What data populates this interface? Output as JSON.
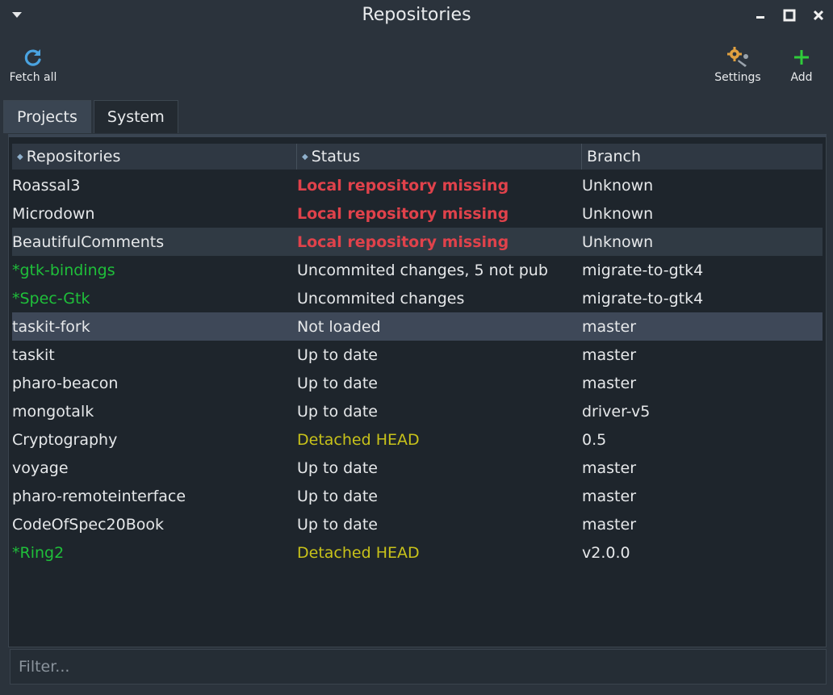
{
  "window": {
    "title": "Repositories",
    "menu_icon": "triangle-down-icon",
    "controls": [
      "minimize-icon",
      "maximize-icon",
      "close-icon"
    ]
  },
  "toolbar": {
    "fetch_all": {
      "label": "Fetch all",
      "icon": "refresh-icon",
      "color": "#4aa3e0"
    },
    "settings": {
      "label": "Settings",
      "icon": "gear-wrench-icon",
      "color": "#e0a040"
    },
    "add": {
      "label": "Add",
      "icon": "plus-icon",
      "color": "#2fcc3a"
    }
  },
  "tabs": [
    {
      "label": "Projects",
      "active": true
    },
    {
      "label": "System",
      "active": false
    }
  ],
  "table": {
    "columns": [
      "Repositories",
      "Status",
      "Branch"
    ],
    "rows": [
      {
        "name": "Roassal3",
        "status": "Local repository missing",
        "branch": "Unknown",
        "name_style": "normal",
        "status_style": "red"
      },
      {
        "name": "Microdown",
        "status": "Local repository missing",
        "branch": "Unknown",
        "name_style": "normal",
        "status_style": "red"
      },
      {
        "name": "BeautifulComments",
        "status": "Local repository missing",
        "branch": "Unknown",
        "name_style": "normal",
        "status_style": "red"
      },
      {
        "name": "*gtk-bindings",
        "status": "Uncommited changes, 5 not pub",
        "branch": "migrate-to-gtk4",
        "name_style": "green",
        "status_style": "normal"
      },
      {
        "name": "*Spec-Gtk",
        "status": "Uncommited changes",
        "branch": "migrate-to-gtk4",
        "name_style": "green",
        "status_style": "normal"
      },
      {
        "name": "taskit-fork",
        "status": "Not loaded",
        "branch": "master",
        "name_style": "normal",
        "status_style": "normal"
      },
      {
        "name": "taskit",
        "status": "Up to date",
        "branch": "master",
        "name_style": "normal",
        "status_style": "normal"
      },
      {
        "name": "pharo-beacon",
        "status": "Up to date",
        "branch": "master",
        "name_style": "normal",
        "status_style": "normal"
      },
      {
        "name": "mongotalk",
        "status": "Up to date",
        "branch": "driver-v5",
        "name_style": "normal",
        "status_style": "normal"
      },
      {
        "name": "Cryptography",
        "status": "Detached HEAD",
        "branch": "0.5",
        "name_style": "normal",
        "status_style": "yellow"
      },
      {
        "name": "voyage",
        "status": "Up to date",
        "branch": "master",
        "name_style": "normal",
        "status_style": "normal"
      },
      {
        "name": "pharo-remoteinterface",
        "status": "Up to date",
        "branch": "master",
        "name_style": "normal",
        "status_style": "normal"
      },
      {
        "name": "CodeOfSpec20Book",
        "status": "Up to date",
        "branch": "master",
        "name_style": "normal",
        "status_style": "normal"
      },
      {
        "name": "*Ring2",
        "status": "Detached HEAD",
        "branch": "v2.0.0",
        "name_style": "green",
        "status_style": "yellow"
      }
    ],
    "hover_row": 2,
    "selected_row": 5
  },
  "filter": {
    "placeholder": "Filter...",
    "value": ""
  },
  "colors": {
    "background": "#2b333c",
    "table_bg": "#1e252c",
    "green": "#1fbf3a",
    "red": "#e0424b",
    "yellow": "#c8c21a",
    "selected": "#3e4858"
  }
}
